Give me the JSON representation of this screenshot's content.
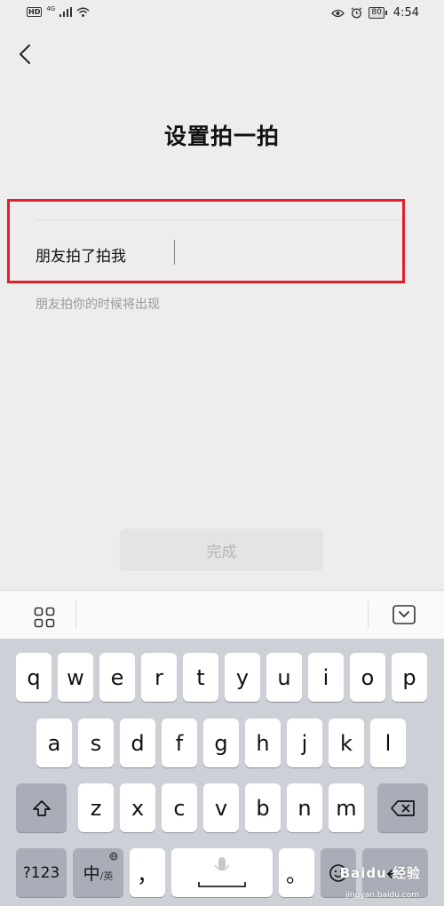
{
  "status_bar": {
    "hd": "HD",
    "network": "4G",
    "battery": "80",
    "time": "4:54"
  },
  "header": {
    "title": "设置拍一拍"
  },
  "input": {
    "value": "朋友拍了拍我"
  },
  "hint": "朋友拍你的时候将出现",
  "done_button": "完成",
  "keyboard": {
    "row1": [
      "q",
      "w",
      "e",
      "r",
      "t",
      "y",
      "u",
      "i",
      "o",
      "p"
    ],
    "row2": [
      "a",
      "s",
      "d",
      "f",
      "g",
      "h",
      "j",
      "k",
      "l"
    ],
    "row3": [
      "z",
      "x",
      "c",
      "v",
      "b",
      "n",
      "m"
    ],
    "num_label": "?123",
    "lang_main": "中",
    "lang_sub": "/英",
    "comma": "，",
    "period": "。"
  },
  "watermark": {
    "brand": "Baidu 经验",
    "url": "jingyan.baidu.com"
  },
  "colors": {
    "highlight": "#e0202c",
    "keyboard_bg": "#cdd0d6"
  }
}
